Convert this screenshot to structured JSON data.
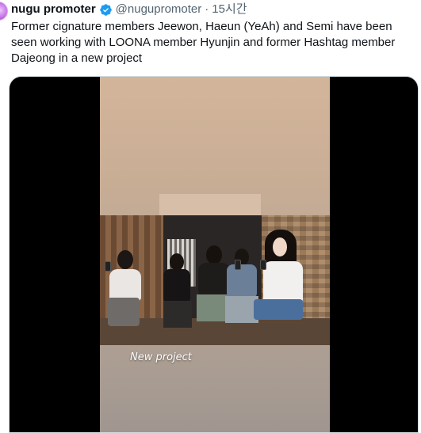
{
  "tweet": {
    "display_name": "nugu promoter",
    "handle": "@nugupromoter",
    "separator": "·",
    "time": "15시간",
    "verified_icon": "verified-badge-icon",
    "accent_color": "#1d9bf0",
    "text": "Former cignature members Jeewon, Haeun (YeAh) and Semi have been seen working with LOONA member Hyunjin and former Hashtag member Dajeong in a new project"
  },
  "media": {
    "caption": "New project"
  }
}
